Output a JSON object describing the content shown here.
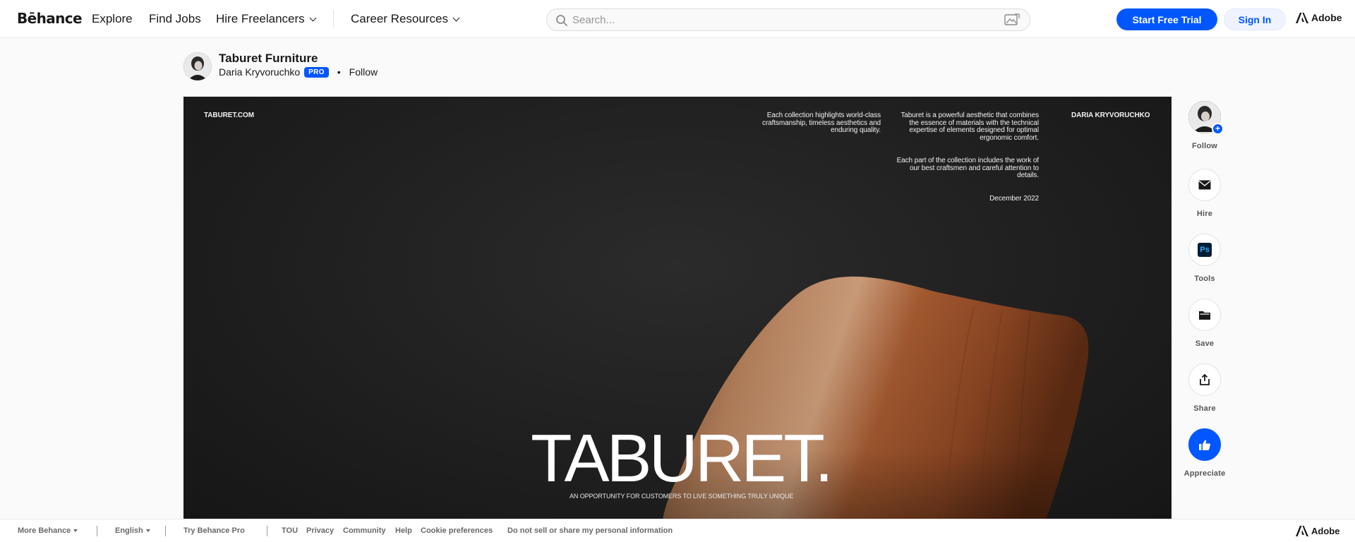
{
  "header": {
    "logo": "Bēhance",
    "nav": [
      {
        "label": "Explore"
      },
      {
        "label": "Find Jobs"
      },
      {
        "label": "Hire Freelancers"
      },
      {
        "label": "Career Resources"
      }
    ],
    "search_placeholder": "Search...",
    "start_trial": "Start Free Trial",
    "sign_in": "Sign In",
    "adobe": "Adobe"
  },
  "project": {
    "title": "Taburet Furniture",
    "owner": "Daria Kryvoruchko",
    "badge": "PRO",
    "follow": "Follow"
  },
  "hero": {
    "site": "TABURET.COM",
    "author": "DARIA KRYVORUCHKO",
    "text1": "Each collection highlights world-class craftsmanship, timeless aesthetics and enduring quality.",
    "text2": "Taburet is a powerful aesthetic that combines the essence of materials with the technical expertise of elements designed for optimal ergonomic comfort.",
    "text3": "Each part of the collection includes the work of our best craftsmen and careful attention to details.",
    "date": "December 2022",
    "title": "TABURET.",
    "tagline": "AN OPPORTUNITY FOR CUSTOMERS TO LIVE SOMETHING TRULY UNIQUE"
  },
  "rail": {
    "follow": "Follow",
    "hire": "Hire",
    "tools": "Tools",
    "tools_icon_text": "Ps",
    "save": "Save",
    "share": "Share",
    "appreciate": "Appreciate"
  },
  "footer": {
    "more": "More Behance",
    "language": "English",
    "try_pro": "Try Behance Pro",
    "links": [
      "TOU",
      "Privacy",
      "Community",
      "Help",
      "Cookie preferences",
      "Do not sell or share my personal information"
    ],
    "adobe": "Adobe"
  },
  "colors": {
    "accent": "#0057ff",
    "text": "#191919",
    "hero_bg": "#232323"
  }
}
